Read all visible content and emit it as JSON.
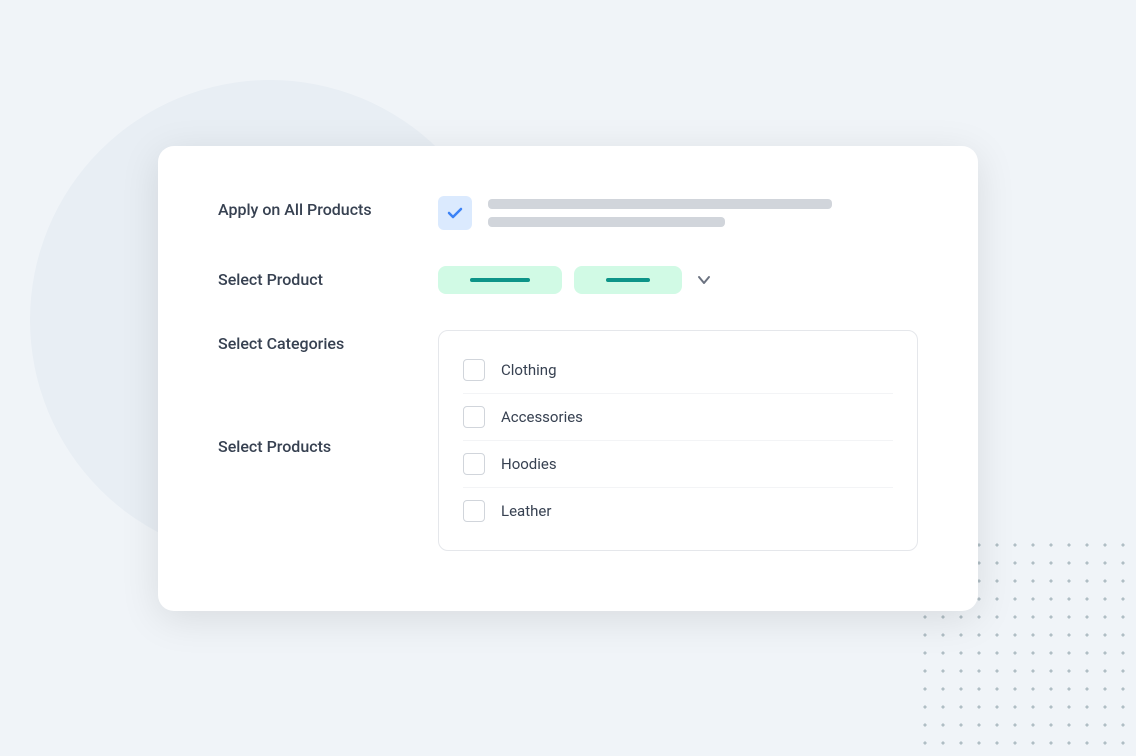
{
  "background": {
    "circle_color": "#e8eef4"
  },
  "card": {
    "rows": [
      {
        "id": "apply-all-products",
        "label": "Apply on All Products",
        "type": "checkbox-with-lines",
        "checked": true
      },
      {
        "id": "select-product",
        "label": "Select Product",
        "type": "pills"
      },
      {
        "id": "select-categories",
        "label": "Select Categories",
        "type": "list",
        "items": [
          "Clothing",
          "Accessories",
          "Hoodies",
          "Leather"
        ]
      },
      {
        "id": "select-products",
        "label": "Select Products",
        "type": "list-only",
        "items": []
      }
    ],
    "categories": {
      "items": [
        {
          "label": "Clothing",
          "checked": false
        },
        {
          "label": "Accessories",
          "checked": false
        },
        {
          "label": "Hoodies",
          "checked": false
        },
        {
          "label": "Leather",
          "checked": false
        }
      ]
    },
    "labels": {
      "apply_all": "Apply on All Products",
      "select_product": "Select Product",
      "select_categories": "Select Categories",
      "select_products": "Select Products",
      "clothing": "Clothing",
      "accessories": "Accessories",
      "hoodies": "Hoodies",
      "leather": "Leather"
    }
  }
}
